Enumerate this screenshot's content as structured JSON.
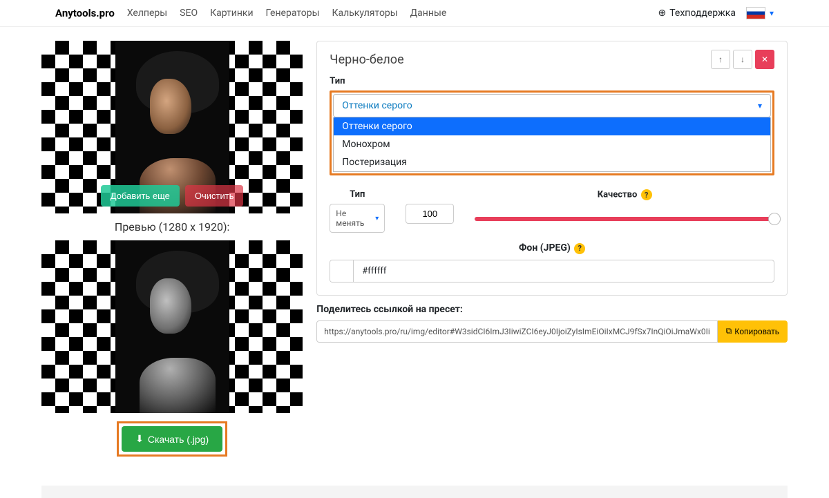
{
  "nav": {
    "brand": "Anytools.pro",
    "items": [
      "Хелперы",
      "SEO",
      "Картинки",
      "Генераторы",
      "Калькуляторы",
      "Данные"
    ],
    "support": "Техподдержка"
  },
  "left": {
    "add_label": "Добавить еще",
    "clear_label": "Очистить",
    "preview_label": "Превью (1280 x 1920):",
    "download_label": "Скачать (.jpg)"
  },
  "panel": {
    "title": "Черно-белое",
    "type_label": "Тип",
    "type_selected": "Оттенки серого",
    "type_options": [
      "Оттенки серого",
      "Монохром",
      "Постеризация"
    ],
    "row2_type_label": "Тип",
    "row2_type_value": "Не менять",
    "quality_label": "Качество",
    "quality_value": "100",
    "bg_label": "Фон (JPEG)",
    "bg_value": "#ffffff"
  },
  "share": {
    "label": "Поделитесь ссылкой на пресет:",
    "url": "https://anytools.pro/ru/img/editor#W3sidCI6ImJ3IiwiZCI6eyJ0IjoiZyIsImEiOiIxMCJ9fSx7InQiOiJmaWx0Ii",
    "copy_label": "Копировать"
  }
}
